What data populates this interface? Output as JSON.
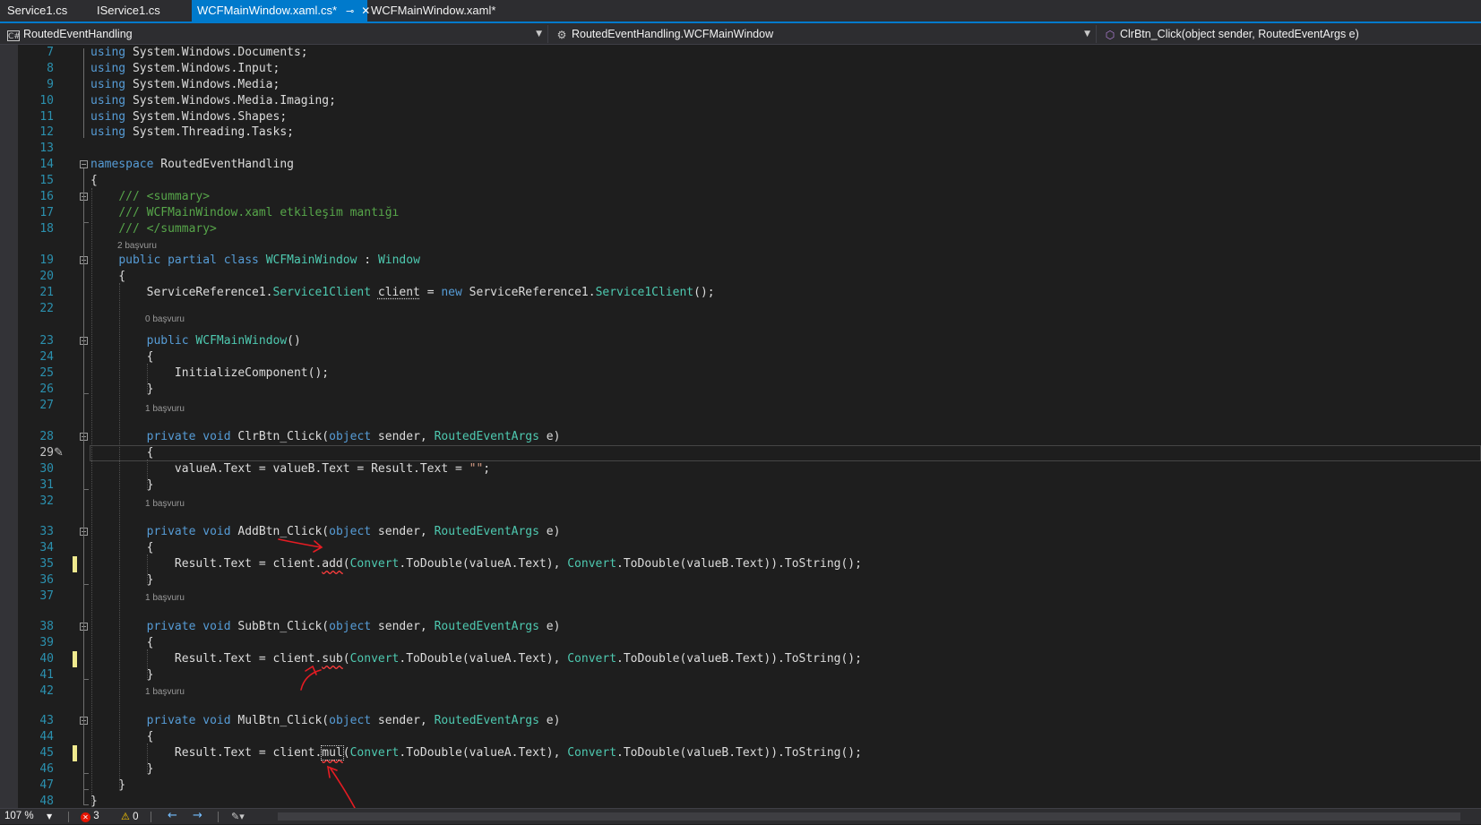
{
  "tabs": [
    {
      "label": "Service1.cs",
      "active": false
    },
    {
      "label": "IService1.cs",
      "active": false
    },
    {
      "label": "WCFMainWindow.xaml.cs*",
      "active": true,
      "pin": "⊸",
      "close": "✕"
    },
    {
      "label": "WCFMainWindow.xaml*",
      "active": false
    }
  ],
  "navbar": {
    "project": {
      "icon": "C#",
      "label": "RoutedEventHandling"
    },
    "type": {
      "label": "RoutedEventHandling.WCFMainWindow"
    },
    "member": {
      "label": "ClrBtn_Click(object sender, RoutedEventArgs e)"
    }
  },
  "codelens": {
    "l19": "2 başvuru",
    "l23": "0 başvuru",
    "l28": "1 başvuru",
    "l33": "1 başvuru",
    "l38": "1 başvuru",
    "l43": "1 başvuru"
  },
  "lines": [
    {
      "n": "7",
      "tokens": [
        {
          "c": "k",
          "v": "using"
        },
        {
          "v": " System.Windows.Documents;"
        }
      ]
    },
    {
      "n": "8",
      "tokens": [
        {
          "c": "k",
          "v": "using"
        },
        {
          "v": " System.Windows.Input;"
        }
      ]
    },
    {
      "n": "9",
      "tokens": [
        {
          "c": "k",
          "v": "using"
        },
        {
          "v": " System.Windows.Media;"
        }
      ]
    },
    {
      "n": "10",
      "tokens": [
        {
          "c": "k",
          "v": "using"
        },
        {
          "v": " System.Windows.Media.Imaging;"
        }
      ]
    },
    {
      "n": "11",
      "tokens": [
        {
          "c": "k",
          "v": "using"
        },
        {
          "v": " System.Windows.Shapes;"
        }
      ]
    },
    {
      "n": "12",
      "tokens": [
        {
          "c": "k",
          "v": "using"
        },
        {
          "v": " System.Threading.Tasks;"
        }
      ]
    },
    {
      "n": "13",
      "tokens": []
    },
    {
      "n": "14",
      "tokens": [
        {
          "c": "k",
          "v": "namespace"
        },
        {
          "v": " RoutedEventHandling"
        }
      ]
    },
    {
      "n": "15",
      "tokens": [
        {
          "v": "{"
        }
      ]
    },
    {
      "n": "16",
      "tokens": [
        {
          "v": "    "
        },
        {
          "c": "c",
          "v": "/// <summary>"
        }
      ]
    },
    {
      "n": "17",
      "tokens": [
        {
          "v": "    "
        },
        {
          "c": "c",
          "v": "/// WCFMainWindow.xaml etkileşim mantığı"
        }
      ]
    },
    {
      "n": "18",
      "tokens": [
        {
          "v": "    "
        },
        {
          "c": "c",
          "v": "/// </summary>"
        }
      ]
    },
    {
      "n": "19",
      "tokens": [
        {
          "v": "    "
        },
        {
          "c": "k",
          "v": "public"
        },
        {
          "v": " "
        },
        {
          "c": "k",
          "v": "partial"
        },
        {
          "v": " "
        },
        {
          "c": "k",
          "v": "class"
        },
        {
          "v": " "
        },
        {
          "c": "t",
          "v": "WCFMainWindow"
        },
        {
          "v": " : "
        },
        {
          "c": "t",
          "v": "Window"
        }
      ]
    },
    {
      "n": "20",
      "tokens": [
        {
          "v": "    {"
        }
      ]
    },
    {
      "n": "21",
      "tokens": [
        {
          "v": "        ServiceReference1."
        },
        {
          "c": "t",
          "v": "Service1Client"
        },
        {
          "v": " "
        },
        {
          "c": "dotted",
          "v": "client"
        },
        {
          "v": " = "
        },
        {
          "c": "k",
          "v": "new"
        },
        {
          "v": " ServiceReference1."
        },
        {
          "c": "t",
          "v": "Service1Client"
        },
        {
          "v": "();"
        }
      ]
    },
    {
      "n": "22",
      "tokens": []
    },
    {
      "n": "23",
      "tokens": [
        {
          "v": "        "
        },
        {
          "c": "k",
          "v": "public"
        },
        {
          "v": " "
        },
        {
          "c": "t",
          "v": "WCFMainWindow"
        },
        {
          "v": "()"
        }
      ]
    },
    {
      "n": "24",
      "tokens": [
        {
          "v": "        {"
        }
      ]
    },
    {
      "n": "25",
      "tokens": [
        {
          "v": "            InitializeComponent();"
        }
      ]
    },
    {
      "n": "26",
      "tokens": [
        {
          "v": "        }"
        }
      ]
    },
    {
      "n": "27",
      "tokens": []
    },
    {
      "n": "28",
      "tokens": [
        {
          "v": "        "
        },
        {
          "c": "k",
          "v": "private"
        },
        {
          "v": " "
        },
        {
          "c": "k",
          "v": "void"
        },
        {
          "v": " ClrBtn_Click("
        },
        {
          "c": "k",
          "v": "object"
        },
        {
          "v": " sender, "
        },
        {
          "c": "t",
          "v": "RoutedEventArgs"
        },
        {
          "v": " e)"
        }
      ]
    },
    {
      "n": "29",
      "tokens": [
        {
          "v": "        {"
        }
      ]
    },
    {
      "n": "30",
      "tokens": [
        {
          "v": "            valueA.Text = valueB.Text = Result.Text = "
        },
        {
          "c": "s",
          "v": "\"\""
        },
        {
          "v": ";"
        }
      ]
    },
    {
      "n": "31",
      "tokens": [
        {
          "v": "        }"
        }
      ]
    },
    {
      "n": "32",
      "tokens": []
    },
    {
      "n": "33",
      "tokens": [
        {
          "v": "        "
        },
        {
          "c": "k",
          "v": "private"
        },
        {
          "v": " "
        },
        {
          "c": "k",
          "v": "void"
        },
        {
          "v": " AddBtn_Click("
        },
        {
          "c": "k",
          "v": "object"
        },
        {
          "v": " sender, "
        },
        {
          "c": "t",
          "v": "RoutedEventArgs"
        },
        {
          "v": " e)"
        }
      ]
    },
    {
      "n": "34",
      "tokens": [
        {
          "v": "        {"
        }
      ]
    },
    {
      "n": "35",
      "tokens": [
        {
          "v": "            Result.Text = client."
        },
        {
          "c": "squig",
          "v": "add"
        },
        {
          "v": "("
        },
        {
          "c": "t",
          "v": "Convert"
        },
        {
          "v": ".ToDouble(valueA.Text), "
        },
        {
          "c": "t",
          "v": "Convert"
        },
        {
          "v": ".ToDouble(valueB.Text)).ToString();"
        }
      ]
    },
    {
      "n": "36",
      "tokens": [
        {
          "v": "        }"
        }
      ]
    },
    {
      "n": "37",
      "tokens": []
    },
    {
      "n": "38",
      "tokens": [
        {
          "v": "        "
        },
        {
          "c": "k",
          "v": "private"
        },
        {
          "v": " "
        },
        {
          "c": "k",
          "v": "void"
        },
        {
          "v": " SubBtn_Click("
        },
        {
          "c": "k",
          "v": "object"
        },
        {
          "v": " sender, "
        },
        {
          "c": "t",
          "v": "RoutedEventArgs"
        },
        {
          "v": " e)"
        }
      ]
    },
    {
      "n": "39",
      "tokens": [
        {
          "v": "        {"
        }
      ]
    },
    {
      "n": "40",
      "tokens": [
        {
          "v": "            Result.Text = client."
        },
        {
          "c": "squig",
          "v": "sub"
        },
        {
          "v": "("
        },
        {
          "c": "t",
          "v": "Convert"
        },
        {
          "v": ".ToDouble(valueA.Text), "
        },
        {
          "c": "t",
          "v": "Convert"
        },
        {
          "v": ".ToDouble(valueB.Text)).ToString();"
        }
      ]
    },
    {
      "n": "41",
      "tokens": [
        {
          "v": "        }"
        }
      ]
    },
    {
      "n": "42",
      "tokens": []
    },
    {
      "n": "43",
      "tokens": [
        {
          "v": "        "
        },
        {
          "c": "k",
          "v": "private"
        },
        {
          "v": " "
        },
        {
          "c": "k",
          "v": "void"
        },
        {
          "v": " MulBtn_Click("
        },
        {
          "c": "k",
          "v": "object"
        },
        {
          "v": " sender, "
        },
        {
          "c": "t",
          "v": "RoutedEventArgs"
        },
        {
          "v": " e)"
        }
      ]
    },
    {
      "n": "44",
      "tokens": [
        {
          "v": "        {"
        }
      ]
    },
    {
      "n": "45",
      "tokens": [
        {
          "v": "            Result.Text = client."
        },
        {
          "c": "squig boxed",
          "v": "mul"
        },
        {
          "v": "("
        },
        {
          "c": "t",
          "v": "Convert"
        },
        {
          "v": ".ToDouble(valueA.Text), "
        },
        {
          "c": "t",
          "v": "Convert"
        },
        {
          "v": ".ToDouble(valueB.Text)).ToString();"
        }
      ]
    },
    {
      "n": "46",
      "tokens": [
        {
          "v": "        }"
        }
      ]
    },
    {
      "n": "47",
      "tokens": [
        {
          "v": "    }"
        }
      ]
    },
    {
      "n": "48",
      "tokens": [
        {
          "v": "}"
        }
      ]
    }
  ],
  "status": {
    "zoom": "107 %",
    "errors": "3",
    "warnings": "0"
  },
  "colors": {
    "accent": "#007acc",
    "keyword": "#569cd6",
    "type": "#4ec9b0",
    "comment": "#57a64a",
    "string": "#d69d85",
    "annotation": "#e51c23"
  }
}
